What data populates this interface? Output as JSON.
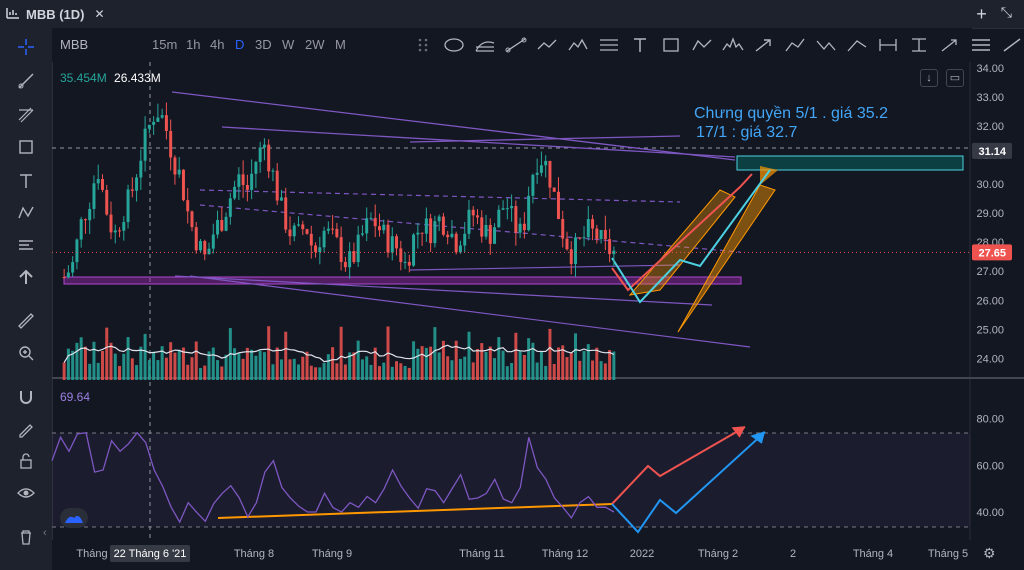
{
  "window": {
    "title": "MBB (1D)"
  },
  "toolbar": {
    "symbol": "MBB",
    "timeframes": [
      "15m",
      "1h",
      "4h",
      "D",
      "3D",
      "W",
      "2W",
      "M"
    ],
    "active_timeframe": "D"
  },
  "legend": {
    "volume_a": "35.454M",
    "volume_b": "26.433M",
    "rsi_value": "69.64"
  },
  "annotation": {
    "line1": "Chưng quyền 5/1 . giá 35.2",
    "line2": "17/1 : giá 32.7"
  },
  "colors": {
    "bg": "#131722",
    "up": "#26a69a",
    "down": "#ef5350",
    "purple": "#9c27b0",
    "teal": "#4dd0e1",
    "orange": "#ff9800",
    "accent": "#2962ff"
  },
  "chart_data": [
    {
      "type": "candlestick",
      "title": "MBB (1D)",
      "y_axis_ticks": [
        34.0,
        33.0,
        32.0,
        31.0,
        30.0,
        29.0,
        28.0,
        27.0,
        26.0,
        25.0,
        24.0
      ],
      "ylim": [
        23.6,
        34.2
      ],
      "price_labels": [
        {
          "value": "31.14",
          "kind": "crosshair"
        },
        {
          "value": "27.65",
          "kind": "last"
        }
      ],
      "x_axis_labels": [
        "Tháng",
        "22 Tháng 6 '21",
        "Tháng 8",
        "Tháng 9",
        "Tháng 11",
        "Tháng 12",
        "2022",
        "Tháng 2",
        "2",
        "Tháng 4",
        "Tháng 5"
      ],
      "close_path": [
        26.8,
        27.2,
        28.6,
        29.4,
        30.6,
        29.2,
        28.2,
        29.0,
        29.6,
        30.8,
        31.8,
        32.6,
        32.2,
        31.0,
        30.2,
        28.8,
        28.0,
        27.4,
        28.4,
        28.8,
        29.6,
        30.2,
        29.8,
        30.8,
        31.4,
        30.4,
        29.2,
        28.4,
        28.2,
        28.6,
        27.6,
        28.4,
        28.2,
        27.8,
        27.2,
        27.6,
        28.4,
        28.8,
        28.4,
        28.0,
        27.8,
        27.2,
        28.2,
        28.6,
        28.4,
        28.8,
        28.6,
        28.0,
        28.4,
        29.0,
        28.6,
        28.2,
        28.8,
        29.4,
        28.6,
        28.2,
        30.2,
        31.0,
        30.6,
        29.4,
        28.2,
        27.6,
        28.0,
        28.4,
        28.2,
        27.8,
        27.65
      ],
      "rsi_axis_ticks": [
        80.0,
        60.0,
        40.0
      ],
      "rsi_ylim": [
        28,
        88
      ],
      "rsi_levels": [
        70,
        30
      ],
      "rsi_path": [
        62,
        70,
        66,
        72,
        74,
        56,
        58,
        70,
        66,
        72,
        74,
        68,
        58,
        48,
        42,
        38,
        44,
        40,
        36,
        44,
        48,
        52,
        46,
        40,
        44,
        58,
        62,
        52,
        46,
        44,
        40,
        42,
        48,
        44,
        40,
        46,
        42,
        48,
        44,
        50,
        58,
        52,
        46,
        44,
        50,
        48,
        44,
        52,
        56,
        48,
        46,
        50,
        54,
        48,
        44,
        50,
        72,
        60,
        54,
        46,
        42,
        40,
        44,
        46,
        42,
        40,
        40
      ]
    }
  ]
}
